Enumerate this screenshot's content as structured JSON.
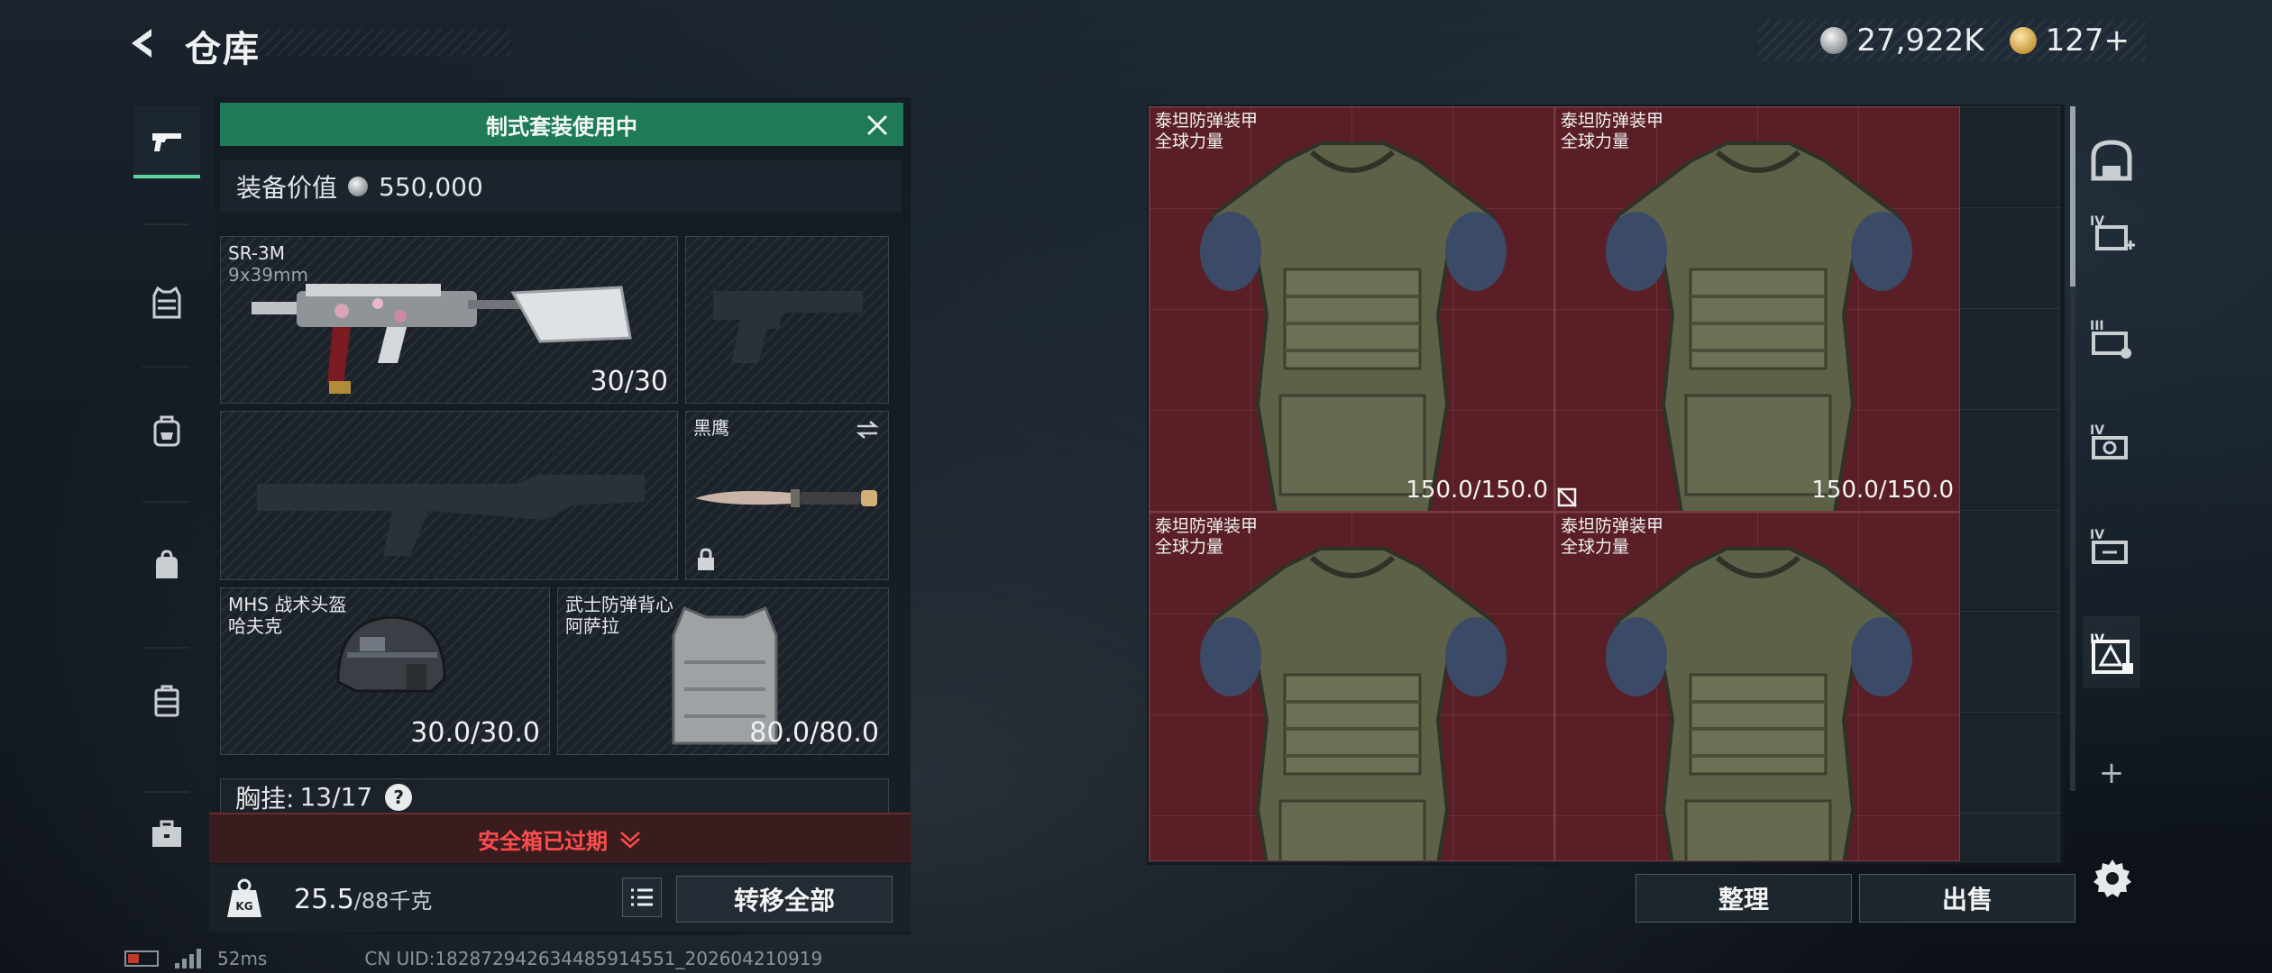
{
  "header": {
    "title": "仓库",
    "currencies": [
      {
        "icon": "silver-coin-icon",
        "value": "27,922K"
      },
      {
        "icon": "gold-coin-icon",
        "value": "127+"
      }
    ]
  },
  "left_tabs": [
    {
      "icon": "pistol-icon",
      "active": true
    },
    {
      "icon": "vest-icon",
      "active": false
    },
    {
      "icon": "backpack-icon",
      "active": false
    },
    {
      "icon": "bag-icon",
      "active": false
    },
    {
      "icon": "box-icon",
      "active": false
    },
    {
      "icon": "briefcase-icon",
      "active": false
    }
  ],
  "loadout": {
    "banner": "制式套装使用中",
    "value_label": "装备价值",
    "value": "550,000",
    "primary": {
      "name": "SR-3M",
      "caliber": "9x39mm",
      "ammo": "30/30"
    },
    "melee": {
      "name": "黑鹰"
    },
    "helmet": {
      "name": "MHS 战术头盔",
      "sub": "哈夫克",
      "durability": "30.0/30.0"
    },
    "armor": {
      "name": "武士防弹背心",
      "sub": "阿萨拉",
      "durability": "80.0/80.0"
    },
    "chest_label": "胸挂:",
    "chest_value": "13/17",
    "chest_help": "?",
    "safe_box": "安全箱已过期",
    "weight_value": "25.5",
    "weight_cap": "/88千克",
    "transfer_all": "转移全部"
  },
  "storage": {
    "items": [
      {
        "name": "泰坦防弹装甲",
        "sub": "全球力量",
        "durability": "150.0/150.0"
      },
      {
        "name": "泰坦防弹装甲",
        "sub": "全球力量",
        "durability": "150.0/150.0"
      },
      {
        "name": "泰坦防弹装甲",
        "sub": "全球力量",
        "durability": ""
      },
      {
        "name": "泰坦防弹装甲",
        "sub": "全球力量",
        "durability": ""
      }
    ],
    "sort_label": "整理",
    "sell_label": "出售"
  },
  "right_tabs": [
    {
      "icon": "safe-house-icon"
    },
    {
      "icon": "storage-tier-iv-add-icon"
    },
    {
      "icon": "storage-tier-iii-icon"
    },
    {
      "icon": "storage-tier-iv-icon"
    },
    {
      "icon": "storage-tier-iv-alt-icon"
    },
    {
      "icon": "storage-tier-iv-active-icon"
    }
  ],
  "add_tab": "+",
  "footer": {
    "ping": "52ms",
    "uid": "CN UID:182872942634485914551_202604210919"
  }
}
